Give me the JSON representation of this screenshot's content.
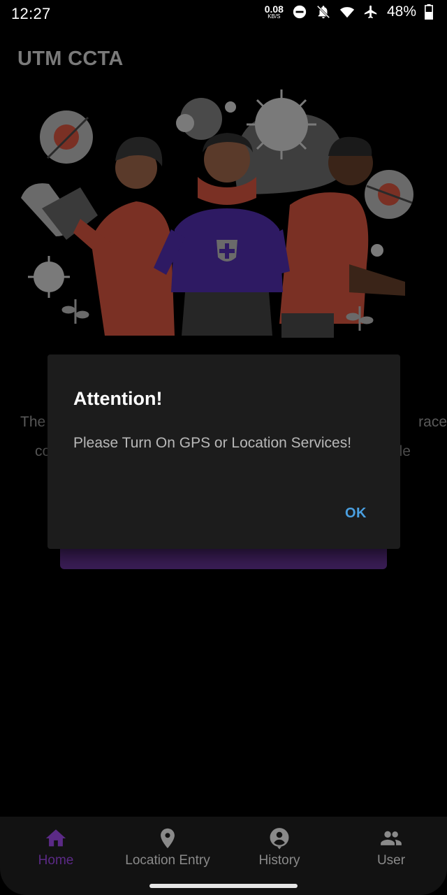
{
  "status_bar": {
    "time": "12:27",
    "net_speed_value": "0.08",
    "net_speed_unit": "KB/S",
    "battery": "48%",
    "icons": [
      "dnd-icon",
      "notifications-off-icon",
      "wifi-icon",
      "airplane-icon",
      "battery-icon"
    ]
  },
  "app": {
    "title": "UTM CCTA"
  },
  "background": {
    "text_line1_left": "The",
    "text_line1_right": "race",
    "text_line2_left": "co",
    "text_line2_right": "le"
  },
  "dialog": {
    "title": "Attention!",
    "message": "Please Turn On GPS or Location Services!",
    "ok_label": "OK"
  },
  "bottom_nav": {
    "items": [
      {
        "label": "Home",
        "icon": "home-icon",
        "active": true
      },
      {
        "label": "Location Entry",
        "icon": "location-pin-icon",
        "active": false
      },
      {
        "label": "History",
        "icon": "history-person-icon",
        "active": false
      },
      {
        "label": "User",
        "icon": "group-icon",
        "active": false
      }
    ]
  },
  "colors": {
    "accent": "#5b2a86",
    "ok_button": "#4a9fe0",
    "dialog_bg": "#1c1c1c"
  }
}
